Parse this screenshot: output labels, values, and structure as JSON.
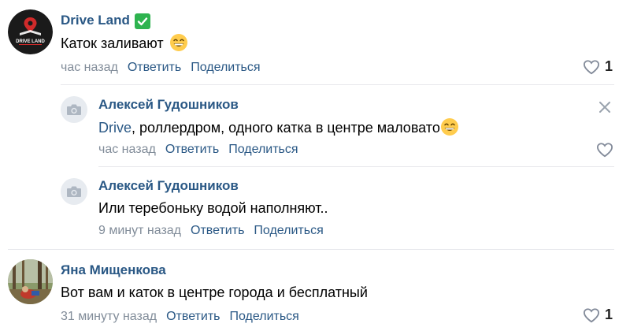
{
  "comments": [
    {
      "author": "Drive Land",
      "logo_text": "DRIVE LAND",
      "text": "Каток заливают",
      "time": "час назад",
      "reply_label": "Ответить",
      "share_label": "Поделиться",
      "likes": "1",
      "verified": true,
      "replies": [
        {
          "author": "Алексей Гудошников",
          "mention": "Drive",
          "text": ", роллердром, одного катка в центре маловато",
          "time": "час назад",
          "reply_label": "Ответить",
          "share_label": "Поделиться"
        },
        {
          "author": "Алексей Гудошников",
          "text": "Или теребоньку водой наполняют..",
          "time": "9 минут назад",
          "reply_label": "Ответить",
          "share_label": "Поделиться"
        }
      ]
    },
    {
      "author": "Яна Мищенкова",
      "text": "Вот вам и каток в центре города и бесплатный",
      "time": "31 минуту назад",
      "reply_label": "Ответить",
      "share_label": "Поделиться",
      "likes": "1"
    }
  ],
  "colors": {
    "link": "#2a5885",
    "meta": "#818c99",
    "divider": "#e7e8ec",
    "verified": "#2eb34f",
    "icon": "#99a2ad"
  }
}
